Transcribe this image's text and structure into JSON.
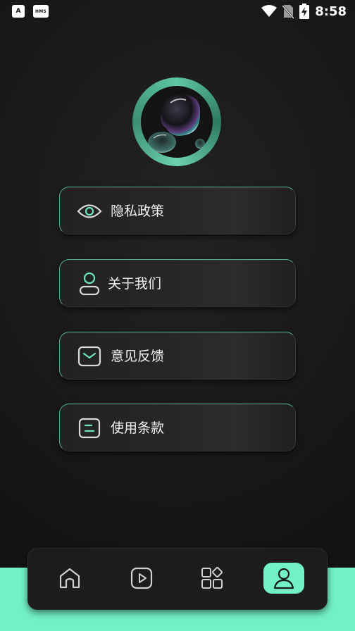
{
  "status_bar": {
    "time": "8:58",
    "app_icons": [
      "A",
      "HMS"
    ]
  },
  "menu": [
    {
      "label": "隐私政策",
      "icon": "eye-icon"
    },
    {
      "label": "关于我们",
      "icon": "person-icon"
    },
    {
      "label": "意见反馈",
      "icon": "mail-icon"
    },
    {
      "label": "使用条款",
      "icon": "document-icon"
    }
  ],
  "bottom_nav": {
    "items": [
      "home",
      "video",
      "apps",
      "profile"
    ],
    "active": "profile"
  },
  "colors": {
    "accent": "#72f0c8",
    "border_accent": "#4fae91",
    "background": "#1a1a1a"
  }
}
